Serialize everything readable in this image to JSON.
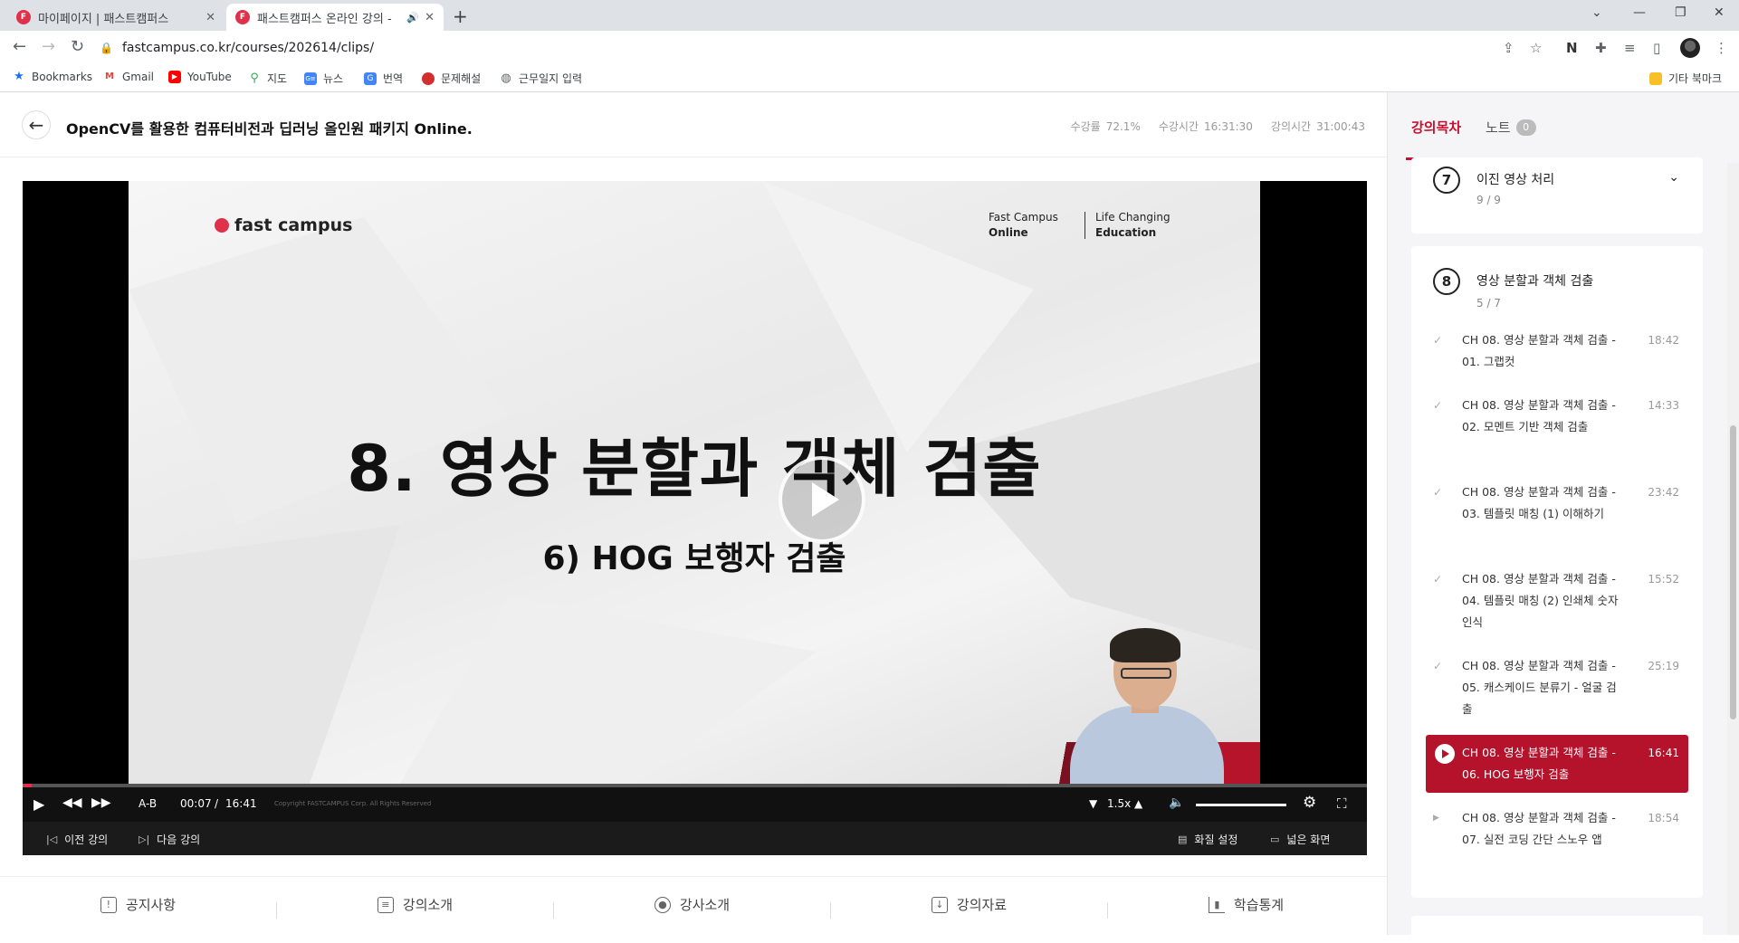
{
  "browser": {
    "tabs": [
      {
        "title": "마이페이지 | 패스트캠퍼스",
        "active": false
      },
      {
        "title": "패스트캠퍼스 온라인 강의 -",
        "active": true
      }
    ],
    "url": "fastcampus.co.kr/courses/202614/clips/",
    "bookmarks": [
      {
        "label": "Bookmarks",
        "icon": "star-icon"
      },
      {
        "label": "Gmail",
        "icon": "gmail-icon"
      },
      {
        "label": "YouTube",
        "icon": "youtube-icon"
      },
      {
        "label": "지도",
        "icon": "maps-icon"
      },
      {
        "label": "뉴스",
        "icon": "news-icon"
      },
      {
        "label": "번역",
        "icon": "translate-icon"
      },
      {
        "label": "문제해설",
        "icon": "bookmark-icon"
      },
      {
        "label": "근무일지 입력",
        "icon": "globe-icon"
      }
    ],
    "other_bookmarks": "기타 북마크"
  },
  "course": {
    "title": "OpenCV를 활용한 컴퓨터비전과 딥러닝 올인원 패키지 Online.",
    "stats": [
      {
        "label": "수강률",
        "value": "72.1%"
      },
      {
        "label": "수강시간",
        "value": "16:31:30"
      },
      {
        "label": "강의시간",
        "value": "31:00:43"
      }
    ]
  },
  "video": {
    "brand": "fast campus",
    "tagline_left": [
      "Fast Campus",
      "Online"
    ],
    "tagline_right": [
      "Life Changing",
      "Education"
    ],
    "slide_title": "8. 영상 분할과 객체 검출",
    "slide_subtitle": "6) HOG 보행자 검출",
    "progress_fraction": 0.007,
    "ab_label": "A-B",
    "current_time": "00:07",
    "time_sep": "/",
    "duration": "16:41",
    "speed": "1.5x",
    "copyright": "Copyright FASTCAMPUS Corp. All Rights Reserved",
    "prev_label": "이전 강의",
    "next_label": "다음 강의",
    "quality_label": "화질 설정",
    "wide_label": "넓은 화면"
  },
  "bottom_tabs": [
    {
      "label": "공지사항",
      "icon": "notice-icon"
    },
    {
      "label": "강의소개",
      "icon": "clipboard-icon"
    },
    {
      "label": "강사소개",
      "icon": "person-icon"
    },
    {
      "label": "강의자료",
      "icon": "download-icon"
    },
    {
      "label": "학습통계",
      "icon": "stats-icon"
    }
  ],
  "sidebar": {
    "tab_curriculum": "강의목차",
    "tab_notes": "노트",
    "notes_count": "0",
    "sections": [
      {
        "num": "7",
        "title": "이진 영상 처리",
        "count": "9 / 9"
      },
      {
        "num": "8",
        "title": "영상 분할과 객체 검출",
        "count": "5 / 7"
      }
    ],
    "lessons": [
      {
        "title": "CH 08. 영상 분할과 객체 검출 - 01. 그랩컷",
        "duration": "18:42",
        "status": "done"
      },
      {
        "title": "CH 08. 영상 분할과 객체 검출 - 02. 모멘트 기반 객체 검출",
        "duration": "14:33",
        "status": "done"
      },
      {
        "title": "CH 08. 영상 분할과 객체 검출 - 03. 템플릿 매칭 (1) 이해하기",
        "duration": "23:42",
        "status": "done"
      },
      {
        "title": "CH 08. 영상 분할과 객체 검출 - 04. 템플릿 매칭 (2) 인쇄체 숫자 인식",
        "duration": "15:52",
        "status": "done"
      },
      {
        "title": "CH 08. 영상 분할과 객체 검출 - 05. 캐스케이드 분류기 - 얼굴 검출",
        "duration": "25:19",
        "status": "done"
      },
      {
        "title": "CH 08. 영상 분할과 객체 검출 - 06. HOG 보행자 검출",
        "duration": "16:41",
        "status": "playing"
      },
      {
        "title": "CH 08. 영상 분할과 객체 검출 - 07. 실전 코딩 간단 스노우 앱",
        "duration": "18:54",
        "status": "todo"
      }
    ]
  },
  "colors": {
    "accent": "#c8102e",
    "active_lesson": "#b5122b",
    "progress": "#e0314b"
  }
}
